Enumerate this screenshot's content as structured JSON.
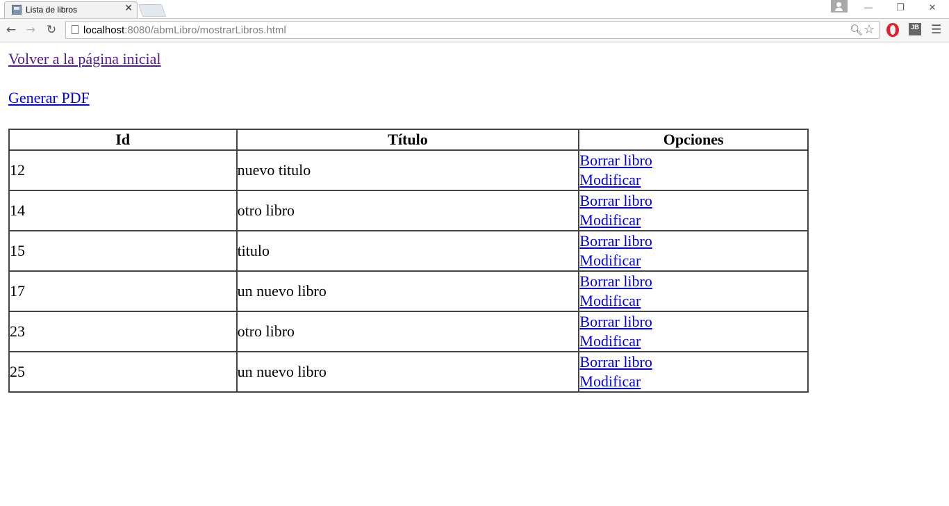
{
  "browser": {
    "tab_title": "Lista de libros",
    "tab_close": "✕",
    "url_host": "localhost",
    "url_rest": ":8080/abmLibro/mostrarLibros.html",
    "window_controls": {
      "minimize": "—",
      "restore": "❐",
      "close": "✕"
    },
    "icons": [
      "back-arrow-icon",
      "forward-arrow-icon",
      "reload-icon",
      "page-icon",
      "zoom-icon",
      "star-icon",
      "opera-icon",
      "jb-icon",
      "menu-icon"
    ],
    "jb_label": "JB"
  },
  "page": {
    "back_link": "Volver a la página inicial",
    "pdf_link": "Generar PDF",
    "link_colors": {
      "visited": "#551a8b",
      "unvisited": "#0000ee"
    }
  },
  "table": {
    "headers": [
      "Id",
      "Título",
      "Opciones"
    ],
    "delete_label": "Borrar libro",
    "modify_label": "Modificar",
    "rows": [
      {
        "id": "12",
        "title": "nuevo titulo",
        "delete": "Borrar libro",
        "modify": "Modificar"
      },
      {
        "id": "14",
        "title": "otro libro",
        "delete": "Borrar libro",
        "modify": "Modificar"
      },
      {
        "id": "15",
        "title": "titulo",
        "delete": "Borrar libro",
        "modify": "Modificar"
      },
      {
        "id": "17",
        "title": "un nuevo libro",
        "delete": "Borrar libro",
        "modify": "Modificar"
      },
      {
        "id": "23",
        "title": "otro libro",
        "delete": "Borrar libro",
        "modify": "Modificar"
      },
      {
        "id": "25",
        "title": "un nuevo libro",
        "delete": "Borrar libro",
        "modify": "Modificar"
      }
    ]
  }
}
